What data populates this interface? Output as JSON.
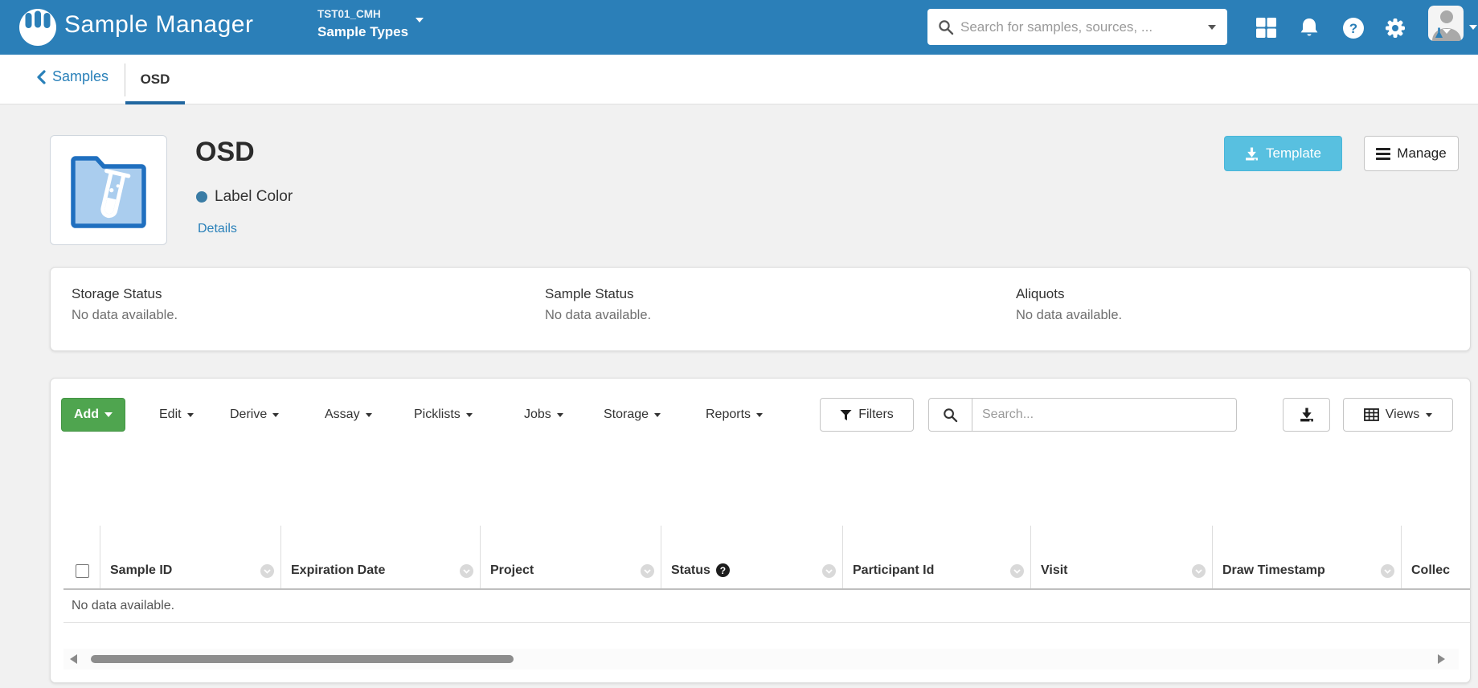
{
  "colors": {
    "header_blue": "#2b7fb8",
    "link_blue": "#2980b9",
    "add_green": "#4fa54f",
    "template_blue": "#58c0e0",
    "label_color_dot": "#3a7ca5",
    "tab_underline": "#2167a0"
  },
  "header": {
    "app_title": "Sample Manager",
    "context_project": "TST01_CMH",
    "context_section": "Sample Types",
    "search_placeholder": "Search for samples, sources, ..."
  },
  "icons": {
    "logo": "labkey-hand-circle",
    "header_right": [
      "apps-grid",
      "bell",
      "help-circle",
      "gear",
      "user-avatar",
      "chevron-down"
    ],
    "column_menu": "chevron-down-circle",
    "status_help": "question-circle"
  },
  "subnav": {
    "back_label": "Samples",
    "active_tab": "OSD"
  },
  "overview": {
    "title": "OSD",
    "label_color_label": "Label Color",
    "details_link": "Details",
    "template_button": "Template",
    "manage_button": "Manage"
  },
  "status_cards": [
    {
      "title": "Storage Status",
      "body": "No data available."
    },
    {
      "title": "Sample Status",
      "body": "No data available."
    },
    {
      "title": "Aliquots",
      "body": "No data available."
    }
  ],
  "grid": {
    "menus": [
      {
        "label": "Add"
      },
      {
        "label": "Edit"
      },
      {
        "label": "Derive"
      },
      {
        "label": "Assay"
      },
      {
        "label": "Picklists"
      },
      {
        "label": "Jobs"
      },
      {
        "label": "Storage"
      },
      {
        "label": "Reports"
      }
    ],
    "filters_button": "Filters",
    "search_placeholder": "Search...",
    "views_button": "Views",
    "columns": [
      {
        "label": "Sample ID"
      },
      {
        "label": "Expiration Date"
      },
      {
        "label": "Project"
      },
      {
        "label": "Status",
        "has_help": true
      },
      {
        "label": "Participant Id"
      },
      {
        "label": "Visit"
      },
      {
        "label": "Draw Timestamp"
      },
      {
        "label": "Collec"
      }
    ],
    "empty_text": "No data available."
  }
}
